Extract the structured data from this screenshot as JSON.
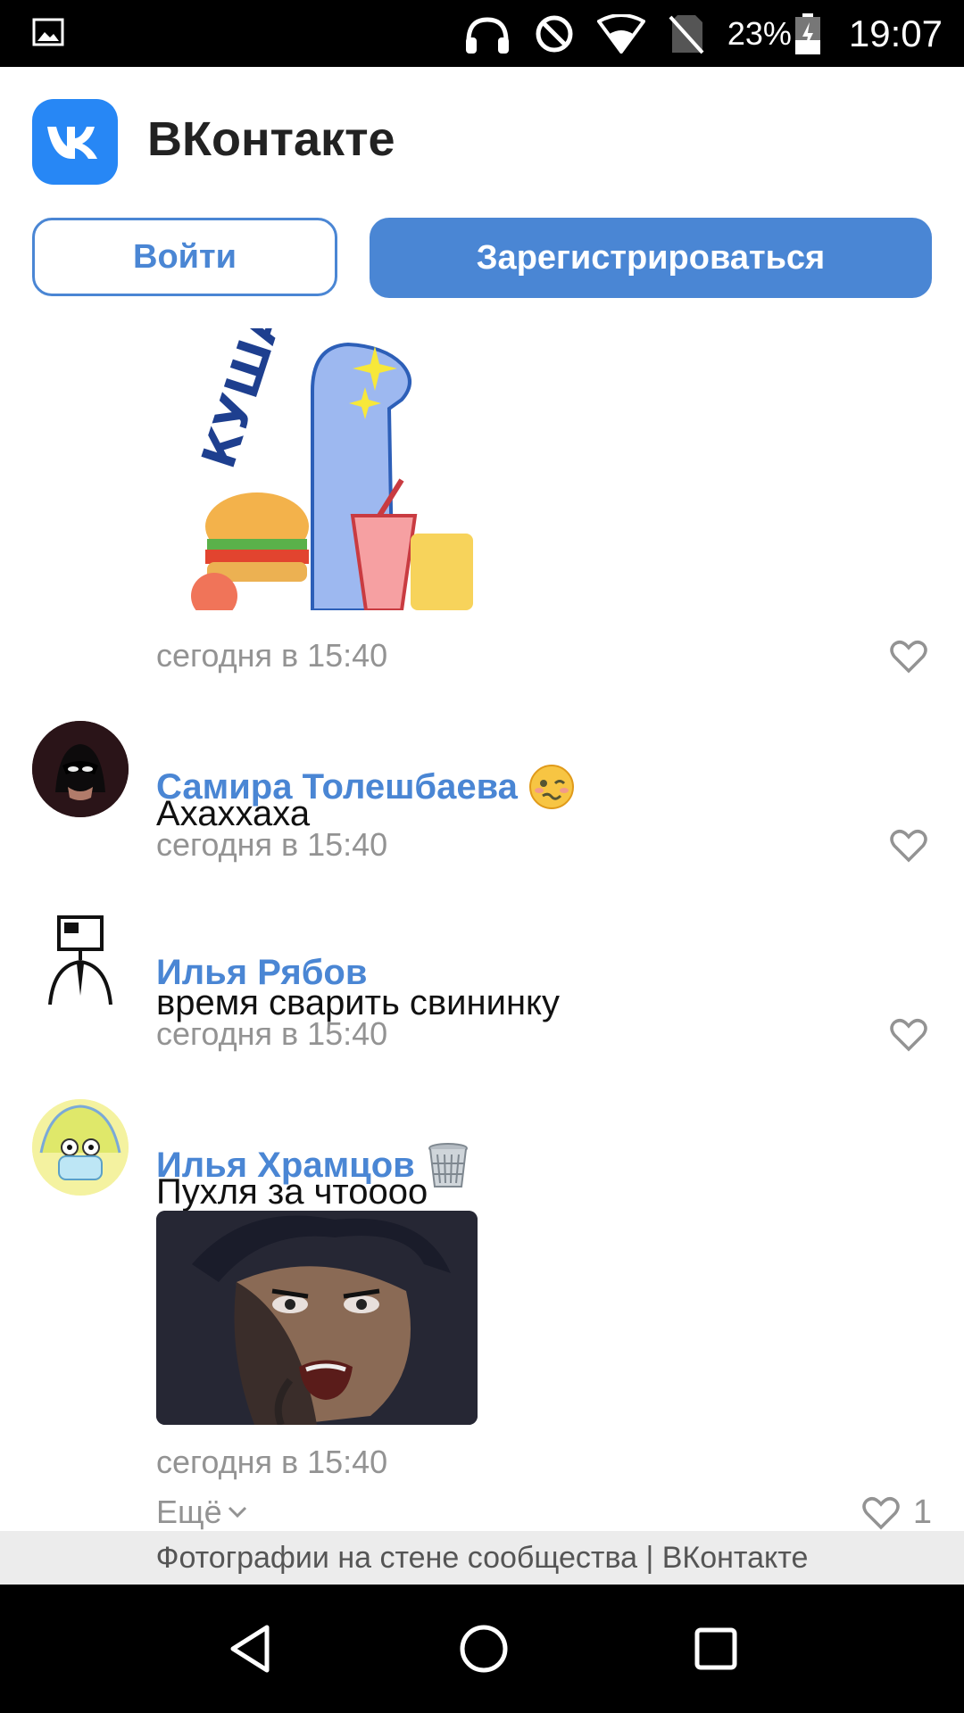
{
  "status_bar": {
    "battery_percent": "23%",
    "time": "19:07",
    "icons": [
      "image-icon",
      "headphones-icon",
      "do-not-disturb-icon",
      "wifi-icon",
      "no-sim-icon",
      "battery-charging-icon"
    ]
  },
  "header": {
    "app_title": "ВКонтакте",
    "login_label": "Войти",
    "register_label": "Зарегистрироваться"
  },
  "feed": {
    "sticker_text": "КУШАЙ",
    "sticker_timestamp": "сегодня в 15:40",
    "comments": [
      {
        "author": "Самира Толешбаева",
        "text": "Ахаххаха",
        "timestamp": "сегодня в 15:40"
      },
      {
        "author": "Илья Рябов",
        "text": "время сварить свининку",
        "timestamp": "сегодня в 15:40"
      },
      {
        "author": "Илья Храмцов",
        "text": "Пухля за чтоооо",
        "timestamp": "сегодня в 15:40"
      }
    ],
    "more_label": "Ещё",
    "like_count": "1"
  },
  "caption": "Фотографии на стене сообщества | ВКонтакте",
  "colors": {
    "accent": "#4a86d4",
    "vk_logo": "#2787f5",
    "timestamp": "#939393"
  }
}
